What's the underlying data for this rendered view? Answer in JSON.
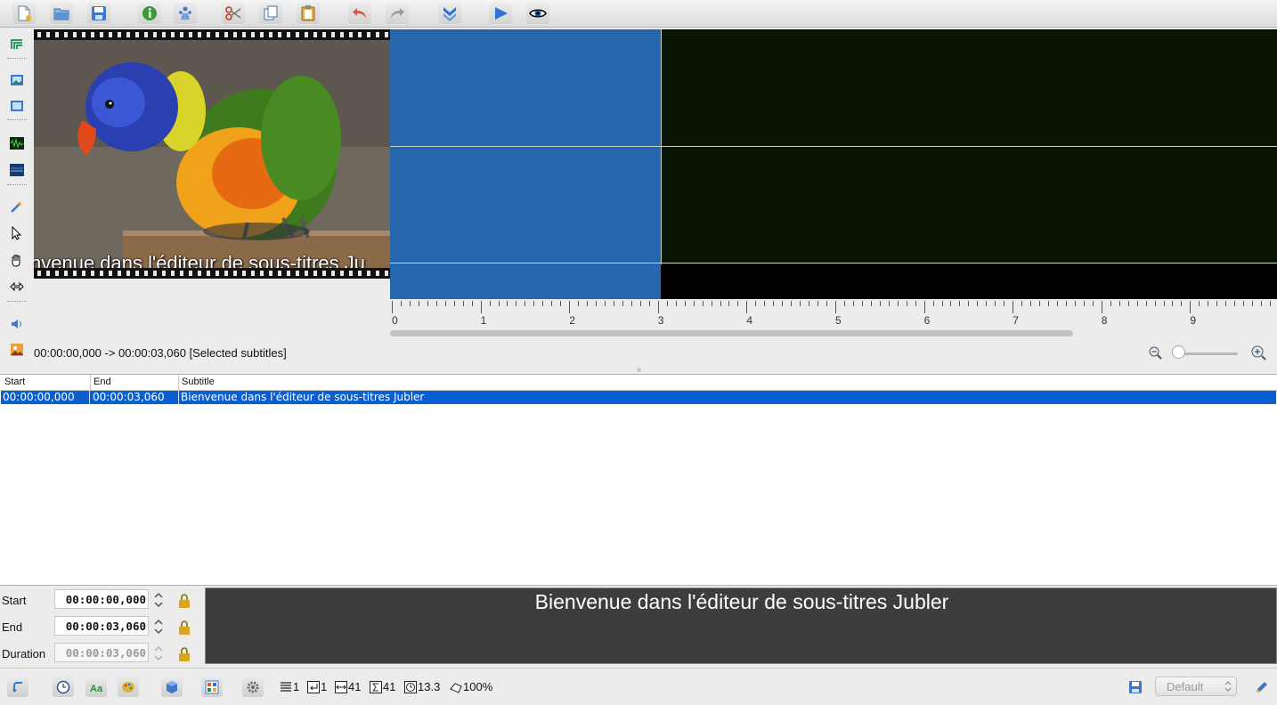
{
  "toolbar": {
    "buttons": [
      "new-file-icon",
      "open-folder-icon",
      "save-icon",
      "info-icon",
      "people-icon",
      "cut-icon",
      "copy-icon",
      "paste-icon",
      "undo-icon",
      "redo-icon",
      "expand-down-icon",
      "play-icon",
      "preview-eye-icon"
    ]
  },
  "lefttools": [
    "audio-waveform-toggle-icon",
    "image-icon",
    "image-small-icon",
    "waveform-icon",
    "spectrum-icon",
    "wand-icon",
    "select-arrow-icon",
    "hand-icon",
    "resize-icon",
    "volume-icon",
    "thumbnail-icon"
  ],
  "video": {
    "subtitle_overlay": "nvenue dans l'éditeur de sous-titres Ju"
  },
  "waveform": {
    "ruler_labels": [
      "0",
      "1",
      "2",
      "3",
      "4",
      "5",
      "6",
      "7",
      "8",
      "9"
    ]
  },
  "infobar": {
    "selection_text": "00:00:00,000 -> 00:00:03,060 [Selected subtitles]",
    "zoom_level": 0.0
  },
  "table": {
    "columns": [
      "Start",
      "End",
      "Subtitle"
    ],
    "rows": [
      {
        "start": "00:00:00,000",
        "end": "00:00:03,060",
        "subtitle": "Bienvenue dans l'éditeur de sous-titres Jubler",
        "selected": true
      }
    ]
  },
  "editor": {
    "start_label": "Start",
    "start_value": "00:00:00,000",
    "end_label": "End",
    "end_value": "00:00:03,060",
    "duration_label": "Duration",
    "duration_value": "00:00:03,060",
    "preview_text": "Bienvenue dans l'éditeur de sous-titres Jubler"
  },
  "statusbar": {
    "lines": "1",
    "newlines": "1",
    "chars_line": "41",
    "total_chars": "41",
    "cps": "13.3",
    "fill": "100%",
    "style_select": "Default"
  },
  "colors": {
    "selection_blue": "#0a5fd0",
    "waveform_selection": "#2566ae",
    "waveform_bg": "#0a1604"
  }
}
